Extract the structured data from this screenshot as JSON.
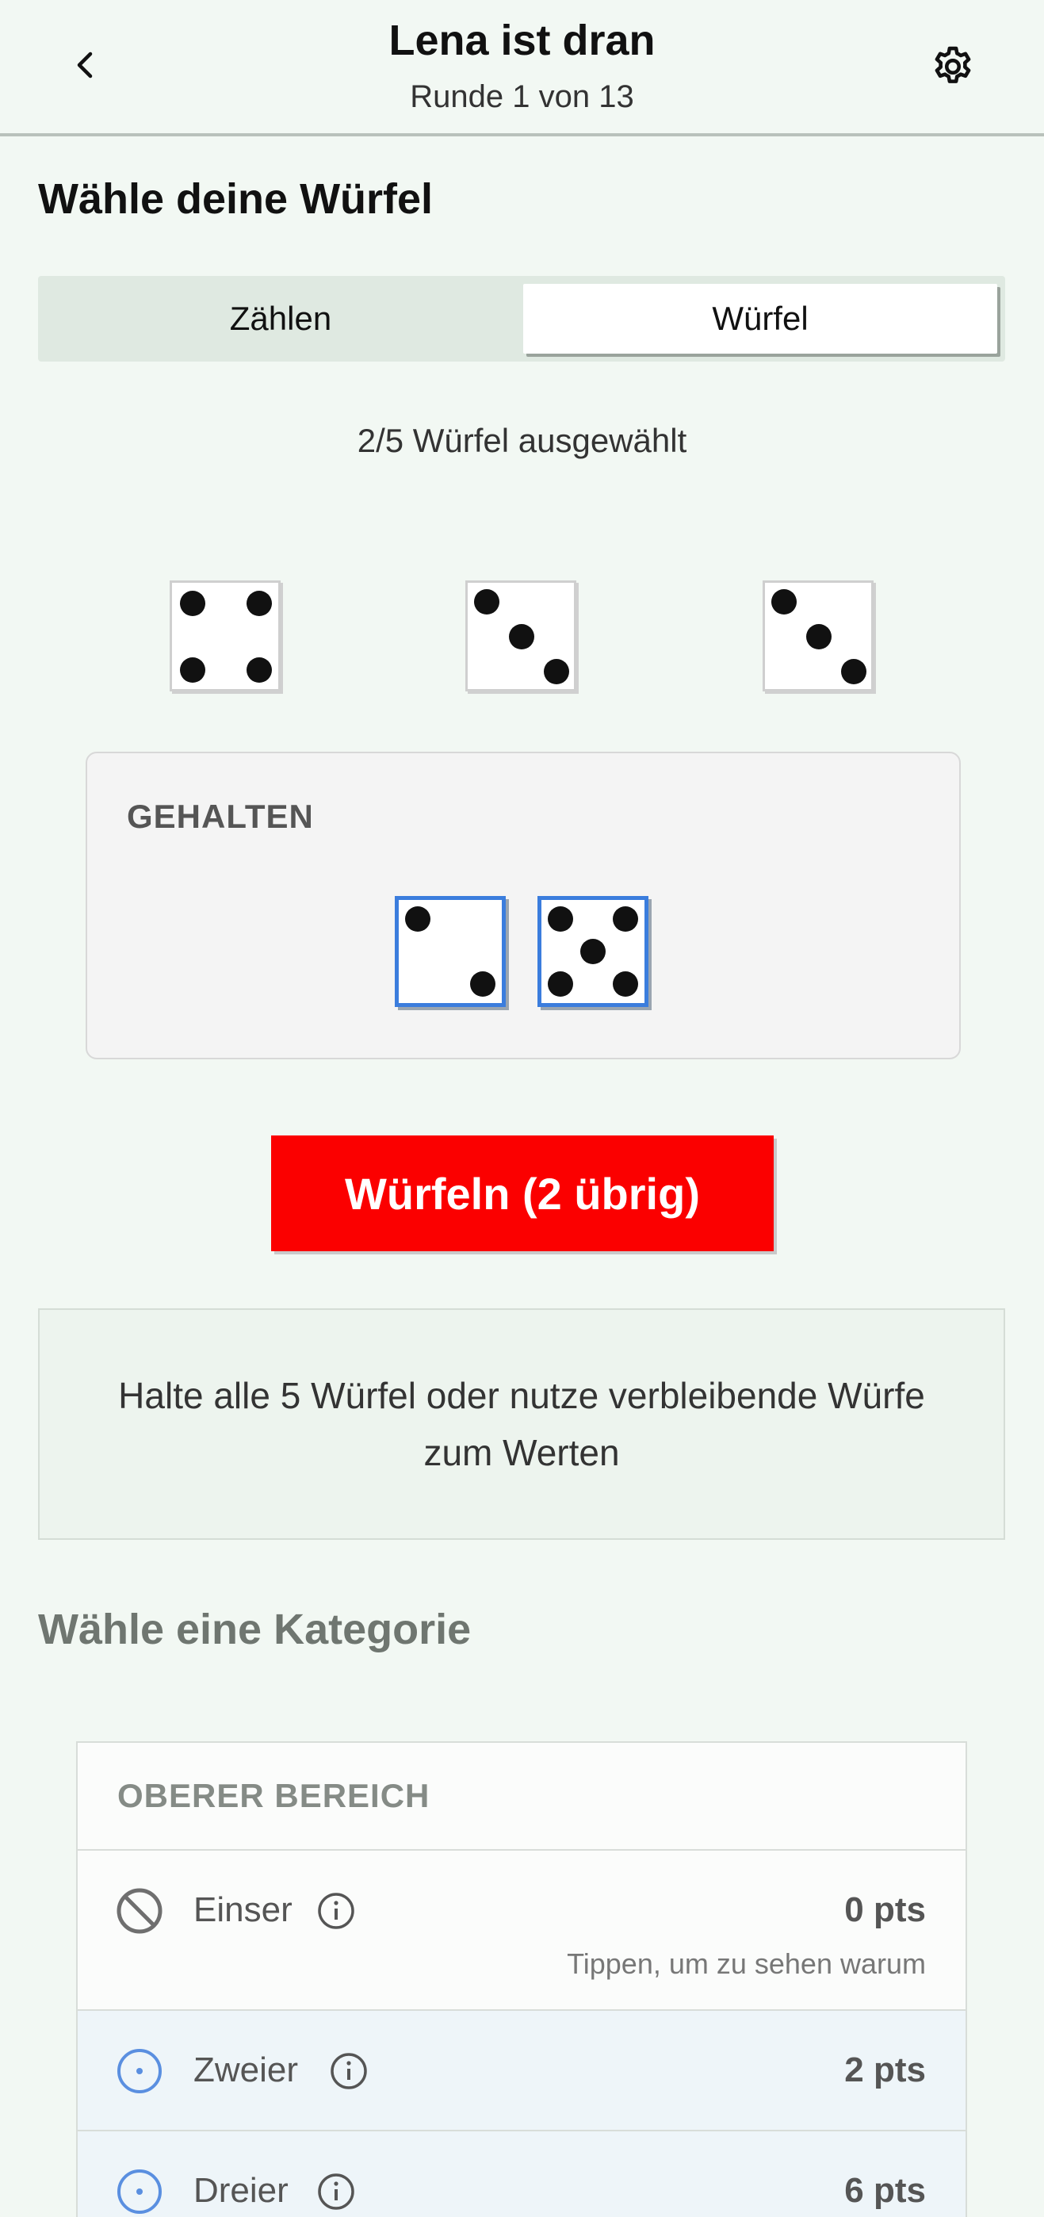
{
  "header": {
    "title": "Lena ist dran",
    "subtitle": "Runde 1 von 13",
    "back_icon": "chevron-left-icon",
    "settings_icon": "gear-icon"
  },
  "selection": {
    "heading": "Wähle deine Würfel",
    "tabs": [
      {
        "label": "Zählen",
        "active": false
      },
      {
        "label": "Würfel",
        "active": true
      }
    ],
    "count_text": "2/5 Würfel ausgewählt"
  },
  "dice": {
    "free": [
      4,
      3,
      3
    ],
    "held_label": "GEHALTEN",
    "held": [
      2,
      5
    ]
  },
  "roll_button": "Würfeln (2 übrig)",
  "hint": "Halte alle 5 Würfel oder nutze verbleibende Würfe zum Werten",
  "categories": {
    "heading": "Wähle eine Kategorie",
    "section_title": "OBERER BEREICH",
    "rows": [
      {
        "label": "Einser",
        "points": "0 pts",
        "note": "Tippen, um zu sehen warum",
        "icon": "blocked-icon"
      },
      {
        "label": "Zweier",
        "points": "2 pts",
        "icon": "radio-icon"
      },
      {
        "label": "Dreier",
        "points": "6 pts",
        "icon": "radio-icon"
      }
    ]
  },
  "colors": {
    "accent": "#3b7ddd",
    "roll_button": "#fb0000",
    "background": "#f2f8f3"
  }
}
